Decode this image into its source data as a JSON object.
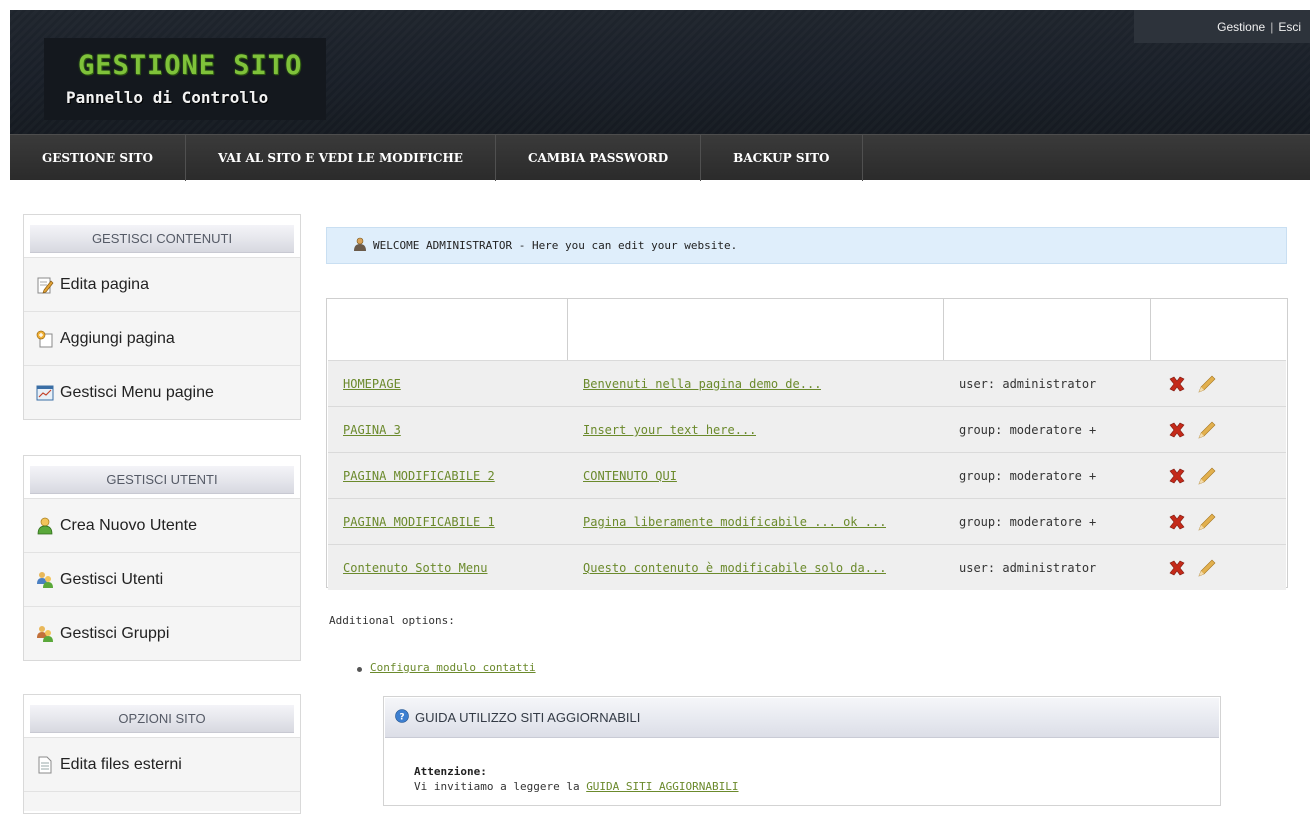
{
  "header": {
    "logo_title": "GESTIONE SITO",
    "logo_subtitle": "Pannello di Controllo",
    "user_links": {
      "manage": "Gestione",
      "separator": "|",
      "logout": "Esci"
    }
  },
  "topnav": {
    "items": [
      {
        "label": "GESTIONE SITO"
      },
      {
        "label": "VAI AL SITO E VEDI LE MODIFICHE"
      },
      {
        "label": "CAMBIA PASSWORD"
      },
      {
        "label": "BACKUP SITO"
      }
    ]
  },
  "sidebar": {
    "contents": {
      "title": "GESTISCI CONTENUTI",
      "items": [
        {
          "label": "Edita pagina",
          "icon": "edit-page-icon"
        },
        {
          "label": "Aggiungi pagina",
          "icon": "add-page-icon"
        },
        {
          "label": "Gestisci Menu pagine",
          "icon": "menu-window-icon"
        }
      ]
    },
    "users": {
      "title": "GESTISCI UTENTI",
      "items": [
        {
          "label": "Crea Nuovo Utente",
          "icon": "new-user-icon"
        },
        {
          "label": "Gestisci Utenti",
          "icon": "users-icon"
        },
        {
          "label": "Gestisci Gruppi",
          "icon": "groups-icon"
        }
      ]
    },
    "options": {
      "title": "OPZIONI SITO",
      "items": [
        {
          "label": "Edita files esterni",
          "icon": "file-icon"
        }
      ]
    }
  },
  "welcome": {
    "text": "WELCOME ADMINISTRATOR - Here you can edit your website."
  },
  "pages_table": {
    "rows": [
      {
        "page": "HOMEPAGE",
        "content": " Benvenuti nella pagina demo de...",
        "owner": "user: administrator"
      },
      {
        "page": "PAGINA 3",
        "content": "Insert your text here...",
        "owner": "group: moderatore +"
      },
      {
        "page": "PAGINA MODIFICABILE 2",
        "content": "CONTENUTO QUI",
        "owner": "group: moderatore +"
      },
      {
        "page": "PAGINA MODIFICABILE 1",
        "content": "Pagina liberamente modificabile ... ok ...",
        "owner": "group: moderatore +"
      },
      {
        "page": "Contenuto Sotto Menu",
        "content": "Questo contenuto è modificabile solo da...",
        "owner": "user: administrator"
      }
    ]
  },
  "additional": {
    "label": "Additional options:",
    "link": "Configura modulo contatti"
  },
  "guide": {
    "title": "GUIDA UTILIZZO SITI AGGIORNABILI",
    "attention": "Attenzione:",
    "text_prefix": "Vi invitiamo a leggere la ",
    "link": "GUIDA SITI AGGIORNABILI"
  },
  "colors": {
    "link": "#6b8a2c",
    "logo_green": "#7fc23a",
    "delete_red": "#c42a1a",
    "edit_pencil": "#d9a441",
    "welcome_bg": "#dfeefb"
  }
}
